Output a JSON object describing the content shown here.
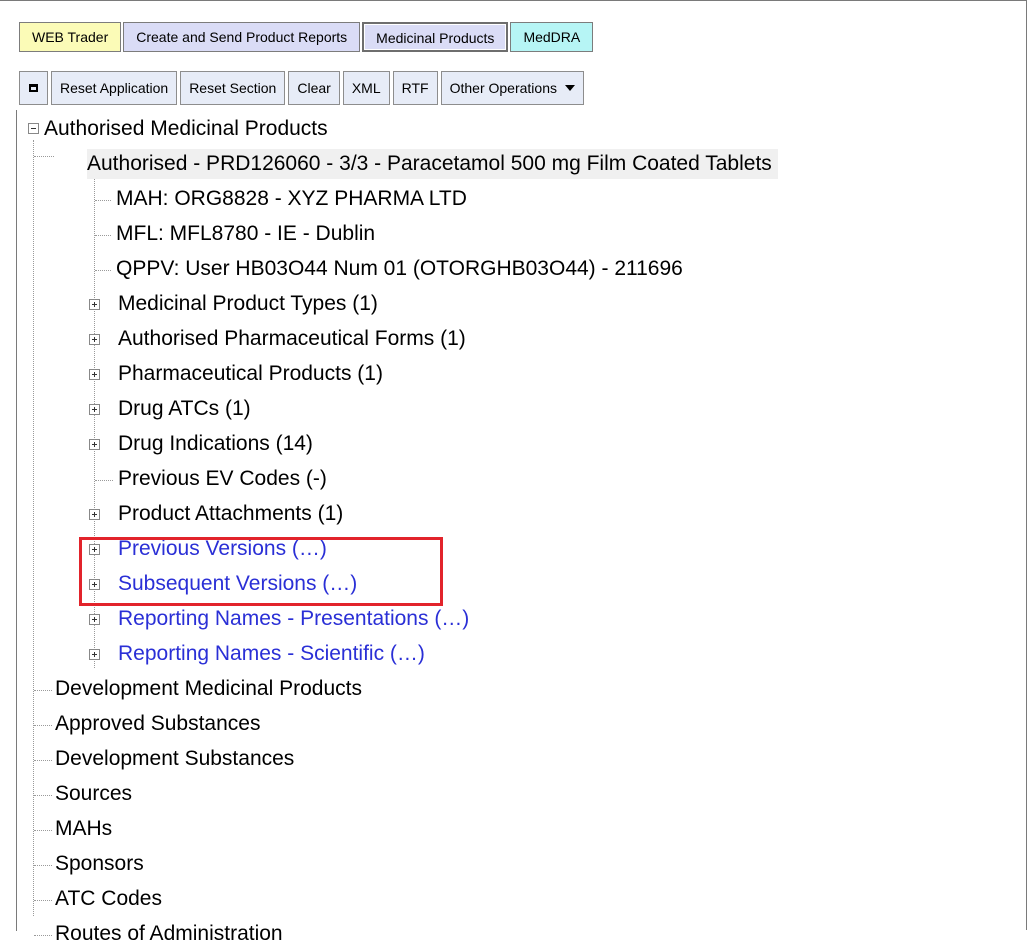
{
  "tabs": {
    "web_trader": "WEB Trader",
    "create_send": "Create and Send Product Reports",
    "medicinal_products": "Medicinal Products",
    "meddra": "MedDRA"
  },
  "toolbar": {
    "maximize_icon": "square-icon",
    "reset_application": "Reset Application",
    "reset_section": "Reset Section",
    "clear": "Clear",
    "xml": "XML",
    "rtf": "RTF",
    "other_operations": "Other Operations"
  },
  "tree": {
    "root": "Authorised Medicinal Products",
    "product": "Authorised - PRD126060 - 3/3 - Paracetamol 500 mg Film Coated Tablets",
    "mah": "MAH: ORG8828 - XYZ PHARMA LTD",
    "mfl": "MFL: MFL8780 - IE - Dublin",
    "qppv": "QPPV: User HB03O44 Num 01 (OTORGHB03O44) - 211696",
    "product_types": "Medicinal Product Types (1)",
    "pharma_forms": "Authorised Pharmaceutical Forms (1)",
    "pharma_products": "Pharmaceutical Products (1)",
    "drug_atcs": "Drug ATCs (1)",
    "drug_indications": "Drug Indications (14)",
    "previous_ev": "Previous EV Codes (-)",
    "attachments": "Product Attachments (1)",
    "previous_versions": "Previous Versions (…)",
    "subsequent_versions": "Subsequent Versions (…)",
    "rn_presentations": "Reporting Names - Presentations (…)",
    "rn_scientific": "Reporting Names - Scientific (…)",
    "development_products": "Development Medicinal Products",
    "approved_substances": "Approved Substances",
    "development_substances": "Development Substances",
    "sources": "Sources",
    "mahs": "MAHs",
    "sponsors": "Sponsors",
    "atc_codes": "ATC Codes",
    "routes": "Routes of Administration"
  },
  "colors": {
    "link": "#2a2fd6",
    "highlight_box": "#e2232b"
  }
}
